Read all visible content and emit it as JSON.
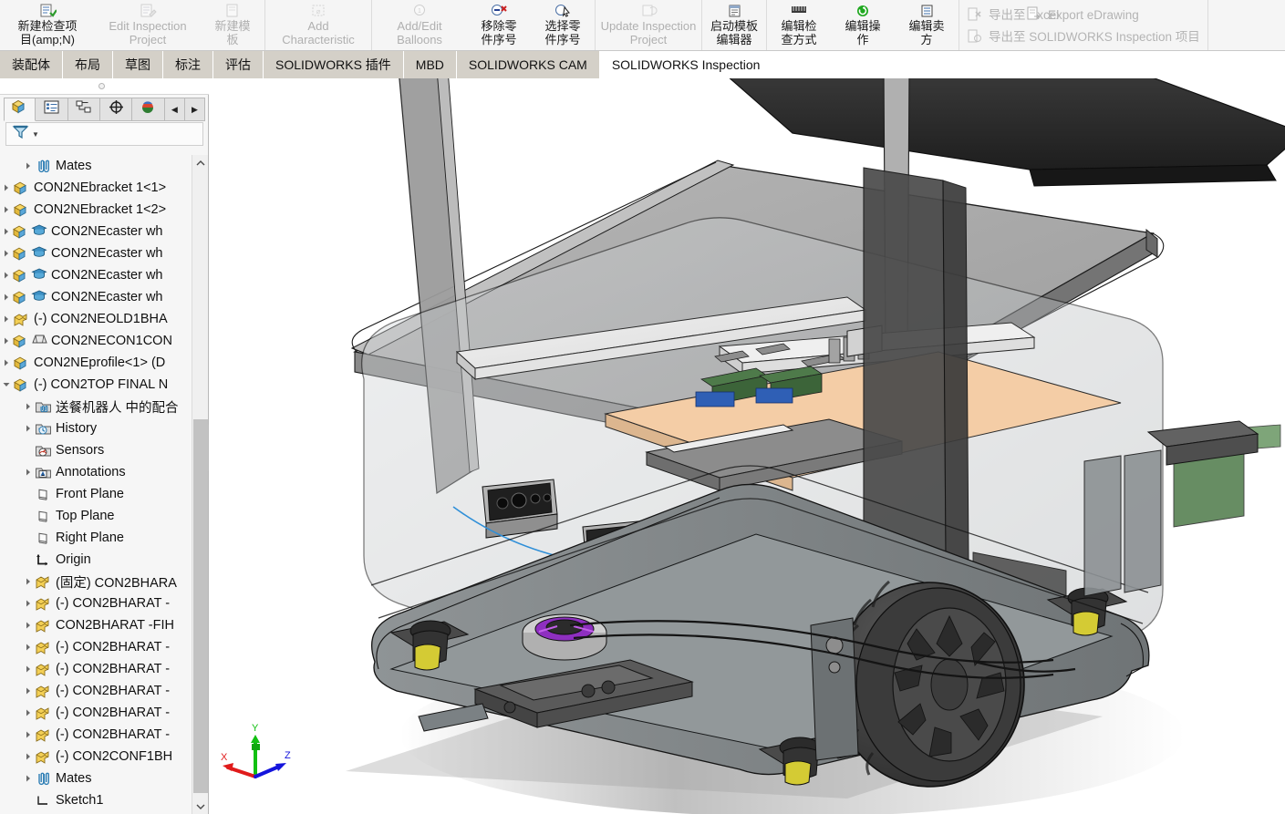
{
  "app": {
    "name": "SOLIDWORKS",
    "accent_blue": "#1a6fb5",
    "tab_inactive_bg": "#d4d0c8",
    "panel_bg": "#f6f6f6"
  },
  "ribbon": {
    "groups": [
      {
        "name": "inspection-project",
        "buttons": [
          {
            "label": "新建检查项\n目(amp;N)",
            "icon": "new-inspection-item-icon",
            "disabled": false,
            "width": "w3"
          },
          {
            "label": "Edit Inspection\nProject",
            "icon": "edit-inspection-project-icon",
            "disabled": true,
            "width": "w4"
          },
          {
            "label": "新建模\n板",
            "icon": "new-template-icon",
            "disabled": true,
            "width": "w5"
          }
        ]
      },
      {
        "name": "characteristic",
        "buttons": [
          {
            "label": "Add\nCharacteristic",
            "icon": "add-characteristic-icon",
            "disabled": true,
            "width": "w4"
          }
        ]
      },
      {
        "name": "balloons",
        "buttons": [
          {
            "label": "Add/Edit\nBalloons",
            "icon": "add-edit-balloons-icon",
            "disabled": true,
            "width": "w3"
          },
          {
            "label": "移除零\n件序号",
            "icon": "remove-balloon-icon",
            "disabled": false,
            "width": "w5"
          },
          {
            "label": "选择零\n件序号",
            "icon": "select-balloon-icon",
            "disabled": false,
            "width": "w5"
          }
        ]
      },
      {
        "name": "update",
        "buttons": [
          {
            "label": "Update Inspection\nProject",
            "icon": "update-inspection-project-icon",
            "disabled": true,
            "width": "w4"
          }
        ]
      },
      {
        "name": "template-editor",
        "buttons": [
          {
            "label": "启动模板\n编辑器",
            "icon": "launch-template-editor-icon",
            "disabled": false,
            "width": "w5"
          }
        ]
      },
      {
        "name": "edit-tools",
        "buttons": [
          {
            "label": "编辑检\n查方式",
            "icon": "edit-inspection-method-icon",
            "disabled": false,
            "width": "w5"
          },
          {
            "label": "编辑操\n作",
            "icon": "edit-operation-icon",
            "disabled": false,
            "width": "w5"
          },
          {
            "label": "编辑卖\n方",
            "icon": "edit-vendor-icon",
            "disabled": false,
            "width": "w5"
          }
        ]
      }
    ],
    "export": {
      "excel_label": "导出至 Excel",
      "excel_icon": "export-excel-icon",
      "sw_label": "导出至 SOLIDWORKS Inspection 项目",
      "sw_icon": "export-solidworks-inspection-icon",
      "edrawing_label": "Export eDrawing",
      "edrawing_icon": "export-edrawing-icon"
    }
  },
  "tabbar": {
    "tabs": [
      {
        "label": "装配体",
        "active": false
      },
      {
        "label": "布局",
        "active": false
      },
      {
        "label": "草图",
        "active": false
      },
      {
        "label": "标注",
        "active": false
      },
      {
        "label": "评估",
        "active": false
      },
      {
        "label": "SOLIDWORKS 插件",
        "active": false
      },
      {
        "label": "MBD",
        "active": false
      },
      {
        "label": "SOLIDWORKS CAM",
        "active": false
      },
      {
        "label": "SOLIDWORKS Inspection",
        "active": true
      }
    ]
  },
  "view_toolbar": {
    "items": [
      {
        "icon": "zoom-to-fit-icon",
        "caret": false,
        "boxed": false
      },
      {
        "icon": "zoom-to-area-icon",
        "caret": false,
        "boxed": false
      },
      {
        "icon": "previous-view-icon",
        "caret": false,
        "boxed": false
      },
      {
        "icon": "section-view-icon",
        "caret": false,
        "boxed": false
      },
      {
        "icon": "view-orientation-icon",
        "caret": false,
        "boxed": false
      },
      {
        "icon": "display-style-icon",
        "caret": true,
        "boxed": false
      },
      {
        "icon": "hide-show-items-icon",
        "caret": true,
        "boxed": false
      },
      {
        "icon": "edit-appearance-icon",
        "caret": false,
        "boxed": true
      },
      {
        "icon": "apply-scene-icon",
        "caret": true,
        "boxed": false
      },
      {
        "icon": "view-settings-icon",
        "caret": true,
        "boxed": false
      }
    ]
  },
  "left_panel": {
    "tabs": [
      {
        "icon": "feature-manager-tree-icon",
        "active": true,
        "name": "feature-manager"
      },
      {
        "icon": "property-manager-icon",
        "active": false,
        "name": "property-manager"
      },
      {
        "icon": "configuration-manager-icon",
        "active": false,
        "name": "configuration-manager"
      },
      {
        "icon": "dimxpert-manager-icon",
        "active": false,
        "name": "dimxpert-manager"
      },
      {
        "icon": "display-manager-icon",
        "active": false,
        "name": "display-manager"
      }
    ],
    "nav_prev": "◀",
    "nav_next": "▶",
    "filter_icon": "filter-icon",
    "tree": [
      {
        "label": "Mates",
        "icon": "mates-icon",
        "indent": 1,
        "arrow": "collapsed"
      },
      {
        "label": "CON2NEbracket 1<1>",
        "icon": "component-icon",
        "indent": 0,
        "arrow": "collapsed"
      },
      {
        "label": "CON2NEbracket 1<2>",
        "icon": "component-icon",
        "indent": 0,
        "arrow": "collapsed"
      },
      {
        "label": "CON2NEcaster wh",
        "icon": "component-icon",
        "icon2": "toolbox-icon",
        "indent": 0,
        "arrow": "collapsed"
      },
      {
        "label": "CON2NEcaster wh",
        "icon": "component-icon",
        "icon2": "toolbox-icon",
        "indent": 0,
        "arrow": "collapsed"
      },
      {
        "label": "CON2NEcaster wh",
        "icon": "component-icon",
        "icon2": "toolbox-icon",
        "indent": 0,
        "arrow": "collapsed"
      },
      {
        "label": "CON2NEcaster wh",
        "icon": "component-icon",
        "icon2": "toolbox-icon",
        "indent": 0,
        "arrow": "collapsed"
      },
      {
        "label": "(-) CON2NEOLD1BHA",
        "icon": "part-icon",
        "indent": 0,
        "arrow": "collapsed"
      },
      {
        "label": "CON2NECON1CON",
        "icon": "component-icon",
        "icon2": "sheetmetal-icon",
        "indent": 0,
        "arrow": "collapsed"
      },
      {
        "label": "CON2NEprofile<1> (D",
        "icon": "component-icon",
        "indent": 0,
        "arrow": "collapsed"
      },
      {
        "label": "(-) CON2TOP FINAL N",
        "icon": "component-icon",
        "indent": 0,
        "arrow": "expanded"
      },
      {
        "label": "送餐机器人 中的配合",
        "icon": "mates-folder-icon",
        "indent": 1,
        "arrow": "collapsed"
      },
      {
        "label": "History",
        "icon": "history-icon",
        "indent": 1,
        "arrow": "collapsed"
      },
      {
        "label": "Sensors",
        "icon": "sensors-icon",
        "indent": 1,
        "arrow": "none"
      },
      {
        "label": "Annotations",
        "icon": "annotations-icon",
        "indent": 1,
        "arrow": "collapsed"
      },
      {
        "label": "Front Plane",
        "icon": "plane-icon",
        "indent": 1,
        "arrow": "none"
      },
      {
        "label": "Top Plane",
        "icon": "plane-icon",
        "indent": 1,
        "arrow": "none"
      },
      {
        "label": "Right Plane",
        "icon": "plane-icon",
        "indent": 1,
        "arrow": "none"
      },
      {
        "label": "Origin",
        "icon": "origin-icon",
        "indent": 1,
        "arrow": "none"
      },
      {
        "label": "(固定) CON2BHARA",
        "icon": "part-icon",
        "indent": 1,
        "arrow": "collapsed"
      },
      {
        "label": "(-) CON2BHARAT -",
        "icon": "part-icon",
        "indent": 1,
        "arrow": "collapsed"
      },
      {
        "label": "CON2BHARAT -FIH",
        "icon": "part-icon",
        "indent": 1,
        "arrow": "collapsed"
      },
      {
        "label": "(-) CON2BHARAT -",
        "icon": "part-icon",
        "indent": 1,
        "arrow": "collapsed"
      },
      {
        "label": "(-) CON2BHARAT -",
        "icon": "part-icon",
        "indent": 1,
        "arrow": "collapsed"
      },
      {
        "label": "(-) CON2BHARAT -",
        "icon": "part-icon",
        "indent": 1,
        "arrow": "collapsed"
      },
      {
        "label": "(-) CON2BHARAT -",
        "icon": "part-icon",
        "indent": 1,
        "arrow": "collapsed"
      },
      {
        "label": "(-) CON2BHARAT -",
        "icon": "part-icon",
        "indent": 1,
        "arrow": "collapsed"
      },
      {
        "label": "(-) CON2CONF1BH",
        "icon": "part-icon",
        "indent": 1,
        "arrow": "collapsed"
      },
      {
        "label": "Mates",
        "icon": "mates-icon",
        "indent": 1,
        "arrow": "collapsed"
      },
      {
        "label": "Sketch1",
        "icon": "sketch-icon",
        "indent": 1,
        "arrow": "none"
      }
    ],
    "scrollbar": {
      "up": "⌃",
      "down": "⌄"
    }
  },
  "viewport": {
    "model_name": "送餐机器人",
    "background": "#ffffff",
    "triad": {
      "x_label": "X",
      "y_label": "Y",
      "z_label": "Z",
      "x_color": "#e01b1b",
      "y_color": "#12c012",
      "z_color": "#1414dc"
    },
    "colors": {
      "body_gray": "#9e9e9e",
      "body_light": "#c4c4c4",
      "body_dark": "#5c5c5c",
      "chassis_black": "#2a2a2a",
      "pcb_orange": "#f2c9a2",
      "pcb_green": "#4e7a4a",
      "estop_red": "#c02a2a",
      "caster_yellow": "#d8cf32",
      "lidar_purple": "#8a1fc0",
      "edge": "#1a1a1a"
    }
  }
}
